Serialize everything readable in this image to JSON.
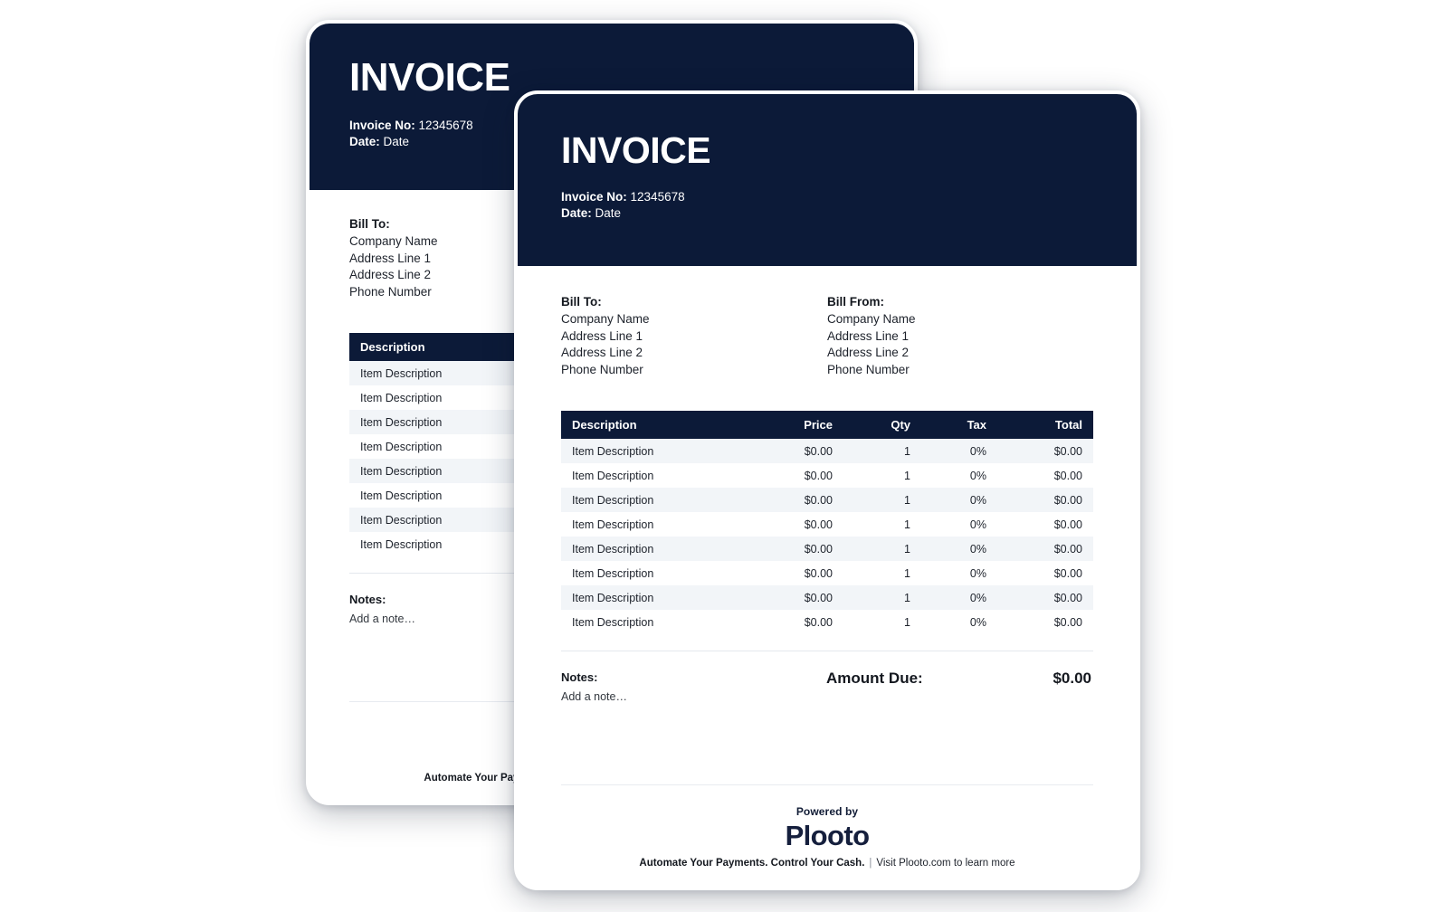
{
  "colors": {
    "navy": "#0c1a38",
    "brand_navy": "#151f3d",
    "row_stripe": "#f2f5f8",
    "page_bg": "#ffffff",
    "rule": "#e4e8ee"
  },
  "invoice": {
    "title": "INVOICE",
    "invoice_no_label": "Invoice No:",
    "invoice_no_value": "12345678",
    "date_label": "Date:",
    "date_value": "Date",
    "bill_to": {
      "heading": "Bill To:",
      "lines": [
        "Company Name",
        "Address Line 1",
        "Address Line 2",
        "Phone Number"
      ]
    },
    "bill_from": {
      "heading": "Bill From:",
      "lines": [
        "Company Name",
        "Address Line 1",
        "Address Line 2",
        "Phone Number"
      ]
    },
    "table": {
      "columns": [
        "Description",
        "Price",
        "Qty",
        "Tax",
        "Total"
      ],
      "rows": [
        {
          "description": "Item Description",
          "price": "$0.00",
          "qty": "1",
          "tax": "0%",
          "total": "$0.00"
        },
        {
          "description": "Item Description",
          "price": "$0.00",
          "qty": "1",
          "tax": "0%",
          "total": "$0.00"
        },
        {
          "description": "Item Description",
          "price": "$0.00",
          "qty": "1",
          "tax": "0%",
          "total": "$0.00"
        },
        {
          "description": "Item Description",
          "price": "$0.00",
          "qty": "1",
          "tax": "0%",
          "total": "$0.00"
        },
        {
          "description": "Item Description",
          "price": "$0.00",
          "qty": "1",
          "tax": "0%",
          "total": "$0.00"
        },
        {
          "description": "Item Description",
          "price": "$0.00",
          "qty": "1",
          "tax": "0%",
          "total": "$0.00"
        },
        {
          "description": "Item Description",
          "price": "$0.00",
          "qty": "1",
          "tax": "0%",
          "total": "$0.00"
        },
        {
          "description": "Item Description",
          "price": "$0.00",
          "qty": "1",
          "tax": "0%",
          "total": "$0.00"
        }
      ]
    },
    "notes": {
      "heading": "Notes:",
      "placeholder": "Add a note…"
    },
    "amount_due": {
      "label": "Amount Due:",
      "value": "$0.00"
    },
    "footer": {
      "powered_by": "Powered by",
      "brand": "Plooto",
      "tagline_strong": "Automate Your Payments. Control Your Cash.",
      "tagline_separator": "|",
      "tagline_link": "Visit Plooto.com to learn more"
    }
  }
}
